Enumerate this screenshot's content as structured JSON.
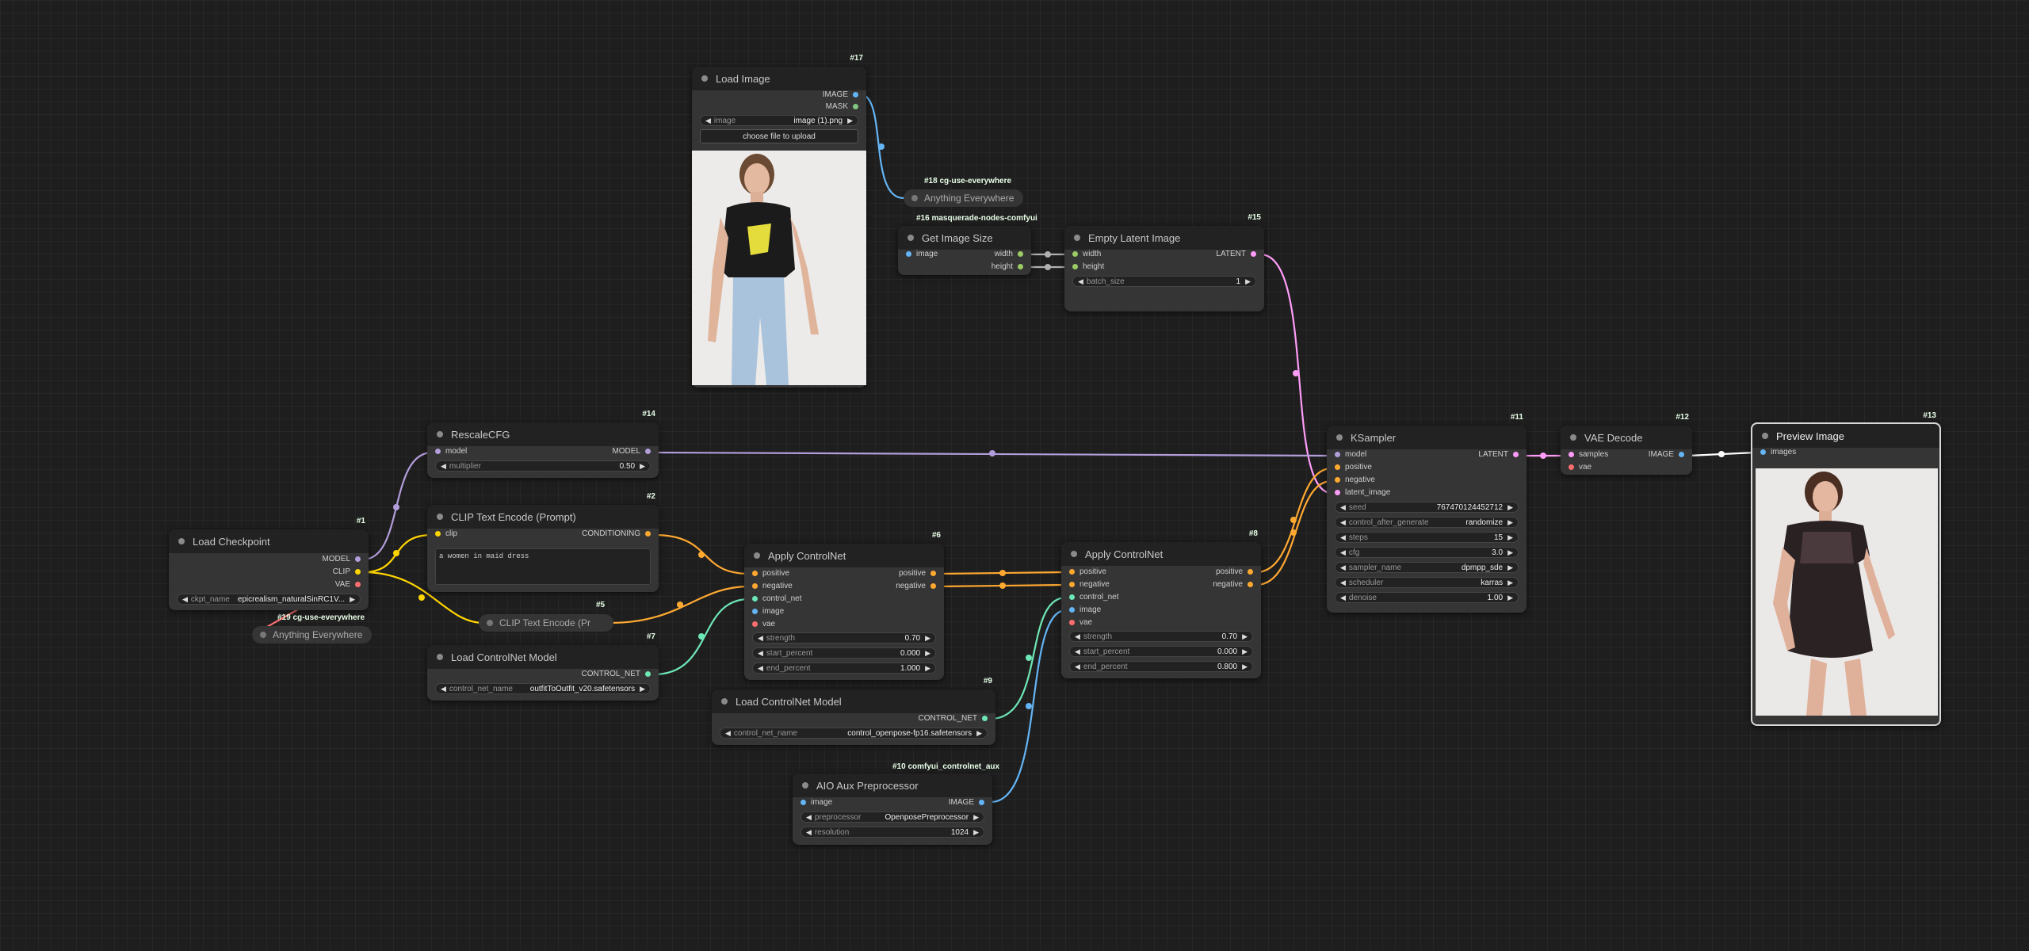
{
  "colors": {
    "model": "#b39ddb",
    "clip": "#ffd500",
    "vae": "#ff6e6e",
    "conditioning": "#ffa931",
    "control_net": "#6ee7b7",
    "image": "#64b5f6",
    "latent": "#ff9cf9",
    "int": "#9ccc65",
    "mask": "#81c784",
    "wire_gray": "#b0b0b0"
  },
  "nodes": {
    "load_image": {
      "id": "#17",
      "title": "Load Image",
      "out_image": "IMAGE",
      "out_mask": "MASK",
      "w_image_label": "image",
      "w_image_value": "image (1).png",
      "upload_label": "choose file to upload"
    },
    "anything18": {
      "tag": "#18 cg-use-everywhere",
      "title": "Anything Everywhere"
    },
    "get_image_size": {
      "tag": "#16 masquerade-nodes-comfyui",
      "title": "Get Image Size",
      "in_image": "image",
      "out_width": "width",
      "out_height": "height"
    },
    "empty_latent": {
      "id": "#15",
      "title": "Empty Latent Image",
      "in_width": "width",
      "in_height": "height",
      "out_latent": "LATENT",
      "w_batch_label": "batch_size",
      "w_batch_value": "1"
    },
    "rescale_cfg": {
      "id": "#14",
      "title": "RescaleCFG",
      "in_model": "model",
      "out_model": "MODEL",
      "w_mult_label": "multiplier",
      "w_mult_value": "0.50"
    },
    "clip_text": {
      "id": "#2",
      "title": "CLIP Text Encode (Prompt)",
      "in_clip": "clip",
      "out_cond": "CONDITIONING",
      "prompt": "a women in maid dress"
    },
    "load_checkpoint": {
      "id": "#1",
      "title": "Load Checkpoint",
      "out_model": "MODEL",
      "out_clip": "CLIP",
      "out_vae": "VAE",
      "w_ckpt_label": "ckpt_name",
      "w_ckpt_value": "epicrealism_naturalSinRC1V..."
    },
    "anything19": {
      "tag": "#19 cg-use-everywhere",
      "title": "Anything Everywhere"
    },
    "clip_text5": {
      "id": "#5",
      "title": "CLIP Text Encode (Pr"
    },
    "load_cn7": {
      "id": "#7",
      "title": "Load ControlNet Model",
      "out_cn": "CONTROL_NET",
      "w_label": "control_net_name",
      "w_value": "outfitToOutfit_v20.safetensors"
    },
    "apply_cn6": {
      "id": "#6",
      "title": "Apply ControlNet",
      "in_pos": "positive",
      "in_neg": "negative",
      "in_cn": "control_net",
      "in_image": "image",
      "in_vae": "vae",
      "out_pos": "positive",
      "out_neg": "negative",
      "w_strength_label": "strength",
      "w_strength_value": "0.70",
      "w_start_label": "start_percent",
      "w_start_value": "0.000",
      "w_end_label": "end_percent",
      "w_end_value": "1.000"
    },
    "apply_cn8": {
      "id": "#8",
      "title": "Apply ControlNet",
      "in_pos": "positive",
      "in_neg": "negative",
      "in_cn": "control_net",
      "in_image": "image",
      "in_vae": "vae",
      "out_pos": "positive",
      "out_neg": "negative",
      "w_strength_label": "strength",
      "w_strength_value": "0.70",
      "w_start_label": "start_percent",
      "w_start_value": "0.000",
      "w_end_label": "end_percent",
      "w_end_value": "0.800"
    },
    "load_cn9": {
      "id": "#9",
      "title": "Load ControlNet Model",
      "out_cn": "CONTROL_NET",
      "w_label": "control_net_name",
      "w_value": "control_openpose-fp16.safetensors"
    },
    "aio": {
      "tag": "#10 comfyui_controlnet_aux",
      "title": "AIO Aux Preprocessor",
      "in_image": "image",
      "out_image": "IMAGE",
      "w_pre_label": "preprocessor",
      "w_pre_value": "OpenposePreprocessor",
      "w_res_label": "resolution",
      "w_res_value": "1024"
    },
    "ksampler": {
      "id": "#11",
      "title": "KSampler",
      "in_model": "model",
      "in_pos": "positive",
      "in_neg": "negative",
      "in_latent": "latent_image",
      "out_latent": "LATENT",
      "widgets": [
        {
          "label": "seed",
          "value": "767470124452712"
        },
        {
          "label": "control_after_generate",
          "value": "randomize"
        },
        {
          "label": "steps",
          "value": "15"
        },
        {
          "label": "cfg",
          "value": "3.0"
        },
        {
          "label": "sampler_name",
          "value": "dpmpp_sde"
        },
        {
          "label": "scheduler",
          "value": "karras"
        },
        {
          "label": "denoise",
          "value": "1.00"
        }
      ]
    },
    "vae_decode": {
      "id": "#12",
      "title": "VAE Decode",
      "in_samples": "samples",
      "in_vae": "vae",
      "out_image": "IMAGE"
    },
    "preview": {
      "id": "#13",
      "title": "Preview Image",
      "in_images": "images"
    }
  }
}
